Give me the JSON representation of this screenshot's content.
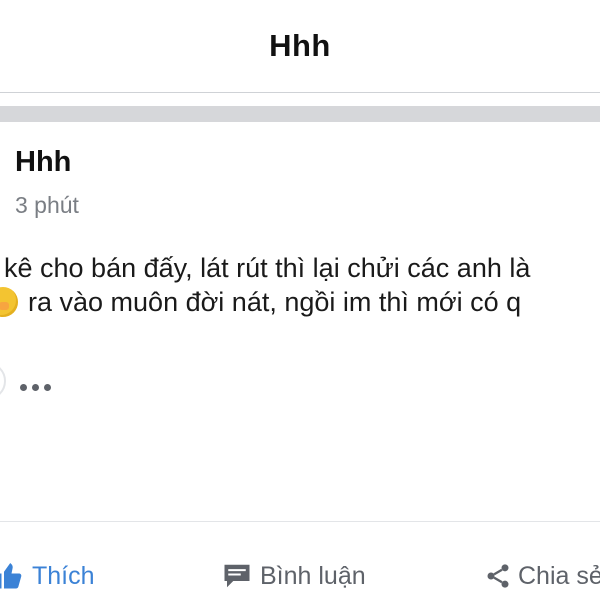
{
  "header": {
    "title": "Hhh"
  },
  "post": {
    "author": "Hhh",
    "time": "3 phút",
    "lines": [
      "kê cho bán đấy, lát rút thì lại chửi các anh là",
      "ra vào muôn đời nát, ngồi im thì mới có q"
    ]
  },
  "actions": {
    "like": "Thích",
    "comment": "Bình luận",
    "share": "Chia sẻ"
  },
  "colors": {
    "like_active": "#3b82d6",
    "action_gray": "#5e6269"
  },
  "icons": {
    "emoji": "emoji-icon",
    "more": "more-icon",
    "like": "thumbs-up-icon",
    "comment": "comment-icon",
    "share": "share-icon"
  }
}
